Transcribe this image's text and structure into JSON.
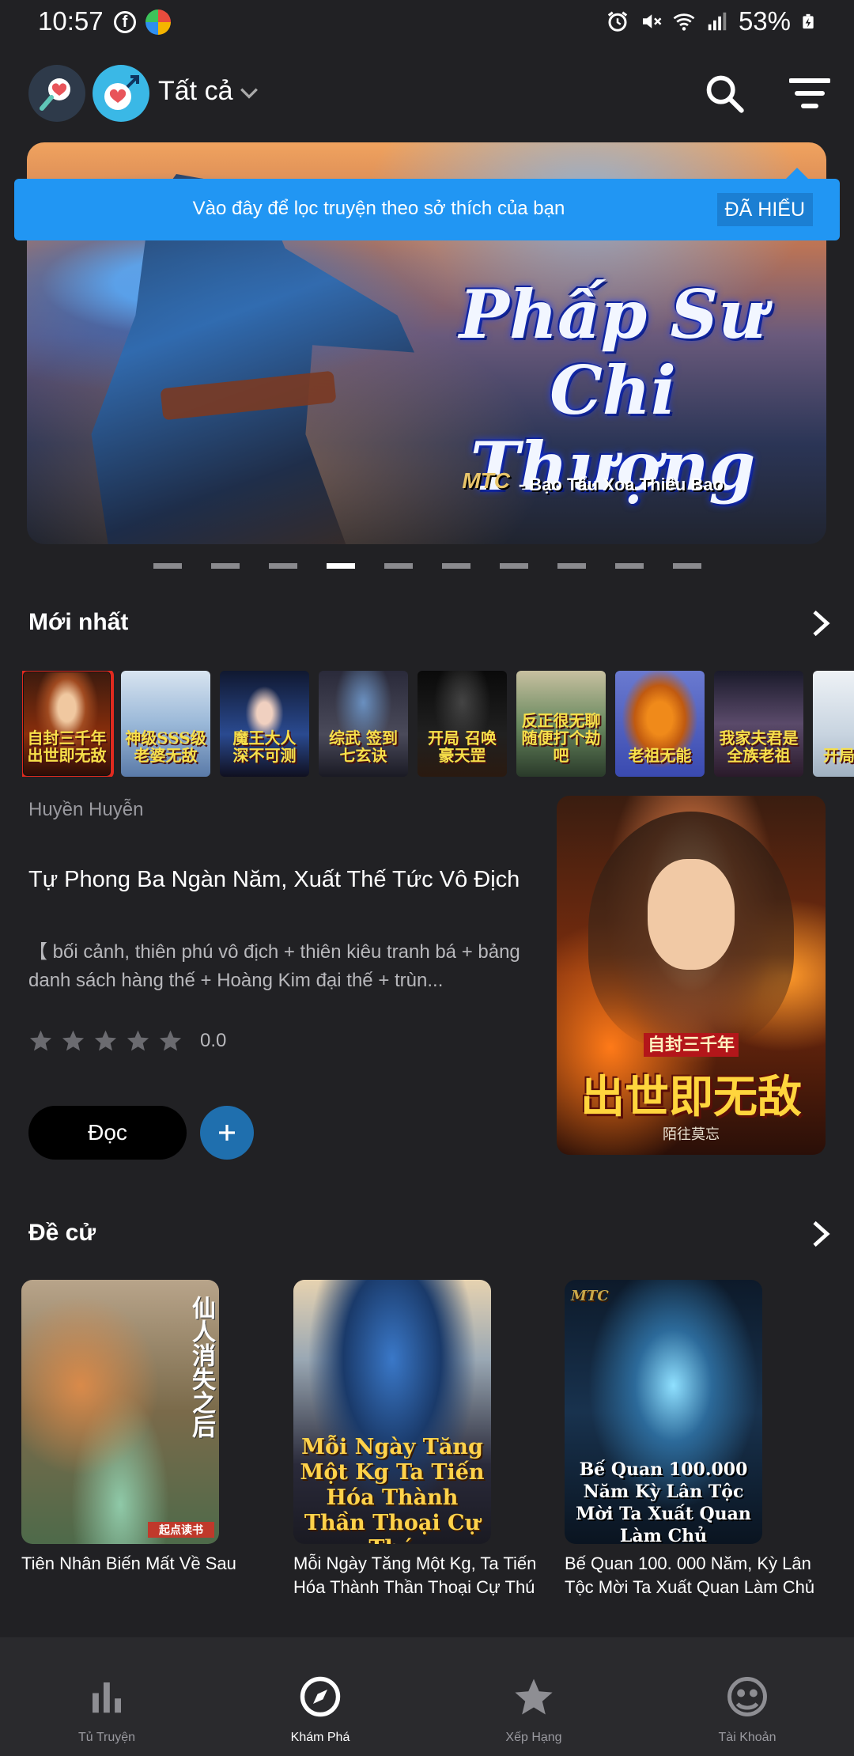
{
  "status_bar": {
    "time": "10:57",
    "battery": "53%"
  },
  "header": {
    "filter_label": "Tất cả"
  },
  "tooltip": {
    "text": "Vào đây để lọc truyện theo sở thích của bạn",
    "button": "ĐÃ HIỂU"
  },
  "banner": {
    "title": "Phấp Sư Chi Thượng",
    "subtitle": "- Bạo Tẩu Xoa Thiêu Bao",
    "logo": "MTC"
  },
  "carousel": {
    "count": 10,
    "active_index": 3
  },
  "newest": {
    "title": "Mới nhất",
    "thumbs": [
      {
        "text": "自封三千年 出世即无敌",
        "selected": true
      },
      {
        "text": "神级SSS级 老婆无敌"
      },
      {
        "text": "魔王大人 深不可测"
      },
      {
        "text": "综武 签到七玄诀"
      },
      {
        "text": "开局 召唤豪天罡"
      },
      {
        "text": "反正很无聊 随便打个劫吧"
      },
      {
        "text": "老祖无能"
      },
      {
        "text": "我家夫君是 全族老祖"
      },
      {
        "text": "开局 封神"
      }
    ],
    "featured": {
      "genre": "Huyền Huyễn",
      "title": "Tự Phong Ba Ngàn Năm, Xuất Thế Tức Vô Địch",
      "description": "【 bối cảnh, thiên phú vô địch + thiên kiêu tranh bá + bảng danh sách hàng thế + Hoàng Kim đại thế + trùn...",
      "rating": "0.0",
      "rating_stars": 0,
      "read_label": "Đọc",
      "cover_small": "自封三千年",
      "cover_main": "出世即无敌",
      "cover_author": "陌往莫忘"
    }
  },
  "recommend": {
    "title": "Đề cử",
    "items": [
      {
        "title": "Tiên Nhân Biến Mất Về Sau",
        "cover_text": "仙人消失之后",
        "cover_publisher": "起点读书"
      },
      {
        "title": "Mỗi Ngày Tăng Một Kg, Ta Tiến Hóa Thành Thần Thoại Cự Thú",
        "cover_text": "Mỗi Ngày Tăng Một Kg Ta Tiến Hóa Thành Thần Thoại Cự Thú"
      },
      {
        "title": "Bế Quan 100. 000 Năm, Kỳ Lân Tộc Mời Ta Xuất Quan Làm Chủ",
        "cover_text": "Bế Quan 100.000 Năm Kỳ Lân Tộc Mời Ta Xuất Quan Làm Chủ",
        "cover_logo": "MTC"
      }
    ]
  },
  "bottom_nav": [
    {
      "label": "Tủ Truyện",
      "icon": "bar-chart-icon"
    },
    {
      "label": "Khám Phá",
      "icon": "compass-icon",
      "active": true
    },
    {
      "label": "Xếp Hạng",
      "icon": "star-icon"
    },
    {
      "label": "Tài Khoản",
      "icon": "account-icon"
    }
  ],
  "colors": {
    "background": "#212124",
    "accent": "#2196f3",
    "add_button": "#1f6fae",
    "selected_outline": "#e02a1f"
  }
}
